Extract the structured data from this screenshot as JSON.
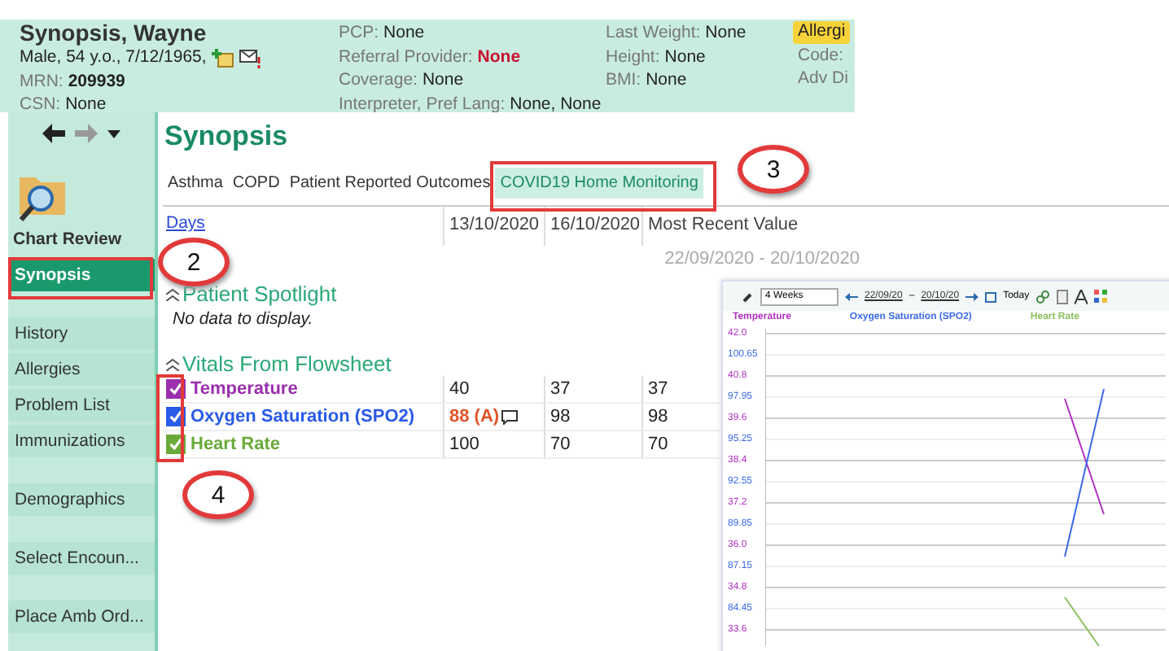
{
  "patient": {
    "name": "Synopsis, Wayne",
    "summary": "Male, 54 y.o., 7/12/1965,",
    "fields": [
      {
        "label": "MRN:",
        "value": "209939",
        "kind": "bold"
      },
      {
        "label": "CSN:",
        "value": "None",
        "kind": "plain"
      }
    ]
  },
  "header_columns": [
    [
      {
        "label": "PCP:",
        "value": "None",
        "kind": "plain"
      },
      {
        "label": "Referral Provider:",
        "value": "None",
        "kind": "alert"
      },
      {
        "label": "Coverage:",
        "value": "None",
        "kind": "plain"
      },
      {
        "label": "Interpreter, Pref Lang:",
        "value": "None, None",
        "kind": "plain"
      }
    ],
    [
      {
        "label": "Last Weight:",
        "value": "None",
        "kind": "plain"
      },
      {
        "label": "Height:",
        "value": "None",
        "kind": "plain"
      },
      {
        "label": "BMI:",
        "value": "None",
        "kind": "plain"
      }
    ]
  ],
  "header_flags": [
    {
      "text": "Allergi",
      "kind": "badge"
    },
    {
      "text": "Code:",
      "kind": "label"
    },
    {
      "text": "Adv Di",
      "kind": "label"
    }
  ],
  "sidebar": {
    "items": [
      {
        "label": "Chart Review",
        "kind": "tile",
        "selected": false
      },
      {
        "label": "Synopsis",
        "kind": "item",
        "selected": true
      },
      {
        "label": "History",
        "kind": "item",
        "selected": false
      },
      {
        "label": "Allergies",
        "kind": "item",
        "selected": false
      },
      {
        "label": "Problem List",
        "kind": "item",
        "selected": false
      },
      {
        "label": "Immunizations",
        "kind": "item",
        "selected": false
      },
      {
        "label": "Demographics",
        "kind": "item",
        "selected": false
      },
      {
        "label": "Select Encoun...",
        "kind": "item",
        "selected": false
      },
      {
        "label": "Place Amb Ord...",
        "kind": "item",
        "selected": false
      }
    ]
  },
  "main": {
    "title": "Synopsis",
    "tabs": [
      {
        "label": "Asthma",
        "selected": false
      },
      {
        "label": "COPD",
        "selected": false
      },
      {
        "label": "Patient Reported Outcomes",
        "selected": false
      },
      {
        "label": "COVID19 Home Monitoring",
        "selected": true
      }
    ],
    "days_link": "Days",
    "columns": [
      "13/10/2020",
      "16/10/2020",
      "Most Recent Value"
    ],
    "date_range": "22/09/2020 - 20/10/2020",
    "sections": [
      {
        "title": "Patient Spotlight",
        "expanded": true,
        "empty_text": "No data to display."
      },
      {
        "title": "Vitals From Flowsheet",
        "expanded": true
      }
    ],
    "vitals": [
      {
        "name": "Temperature",
        "checked": true,
        "color": "#9b2fae",
        "cells": [
          {
            "text": "40",
            "abnormal": false,
            "comment": false
          },
          {
            "text": "37",
            "abnormal": false,
            "comment": false
          },
          {
            "text": "37",
            "abnormal": false,
            "comment": false
          }
        ]
      },
      {
        "name": "Oxygen Saturation (SPO2)",
        "checked": true,
        "color": "#2a5ae8",
        "cells": [
          {
            "text": "88 (A)",
            "abnormal": true,
            "comment": true
          },
          {
            "text": "98",
            "abnormal": false,
            "comment": false
          },
          {
            "text": "98",
            "abnormal": false,
            "comment": false
          }
        ]
      },
      {
        "name": "Heart Rate",
        "checked": true,
        "color": "#6aaa3a",
        "cells": [
          {
            "text": "100",
            "abnormal": false,
            "comment": false
          },
          {
            "text": "70",
            "abnormal": false,
            "comment": false
          },
          {
            "text": "70",
            "abnormal": false,
            "comment": false
          }
        ]
      }
    ]
  },
  "graph_inset": {
    "range": "4 Weeks",
    "start": "22/09/20",
    "separator": "–",
    "end": "20/10/20",
    "today": "Today",
    "legend": [
      {
        "name": "Temperature",
        "color": "#b030c0"
      },
      {
        "name": "Oxygen Saturation (SPO2)",
        "color": "#3a6ae8"
      },
      {
        "name": "Heart Rate",
        "color": "#8cc060"
      }
    ],
    "y_axis_labels": [
      {
        "text": "42.0",
        "kind": "temperature"
      },
      {
        "text": "100.65",
        "kind": "oxygen"
      },
      {
        "text": "40.8",
        "kind": "temperature"
      },
      {
        "text": "97.95",
        "kind": "oxygen"
      },
      {
        "text": "39.6",
        "kind": "temperature"
      },
      {
        "text": "95.25",
        "kind": "oxygen"
      },
      {
        "text": "38.4",
        "kind": "temperature"
      },
      {
        "text": "92.55",
        "kind": "oxygen"
      },
      {
        "text": "37.2",
        "kind": "temperature"
      },
      {
        "text": "89.85",
        "kind": "oxygen"
      },
      {
        "text": "36.0",
        "kind": "temperature"
      },
      {
        "text": "87.15",
        "kind": "oxygen"
      },
      {
        "text": "34.8",
        "kind": "temperature"
      },
      {
        "text": "84.45",
        "kind": "oxygen"
      },
      {
        "text": "33.6",
        "kind": "temperature"
      }
    ]
  },
  "callouts": [
    "2",
    "3",
    "4"
  ]
}
